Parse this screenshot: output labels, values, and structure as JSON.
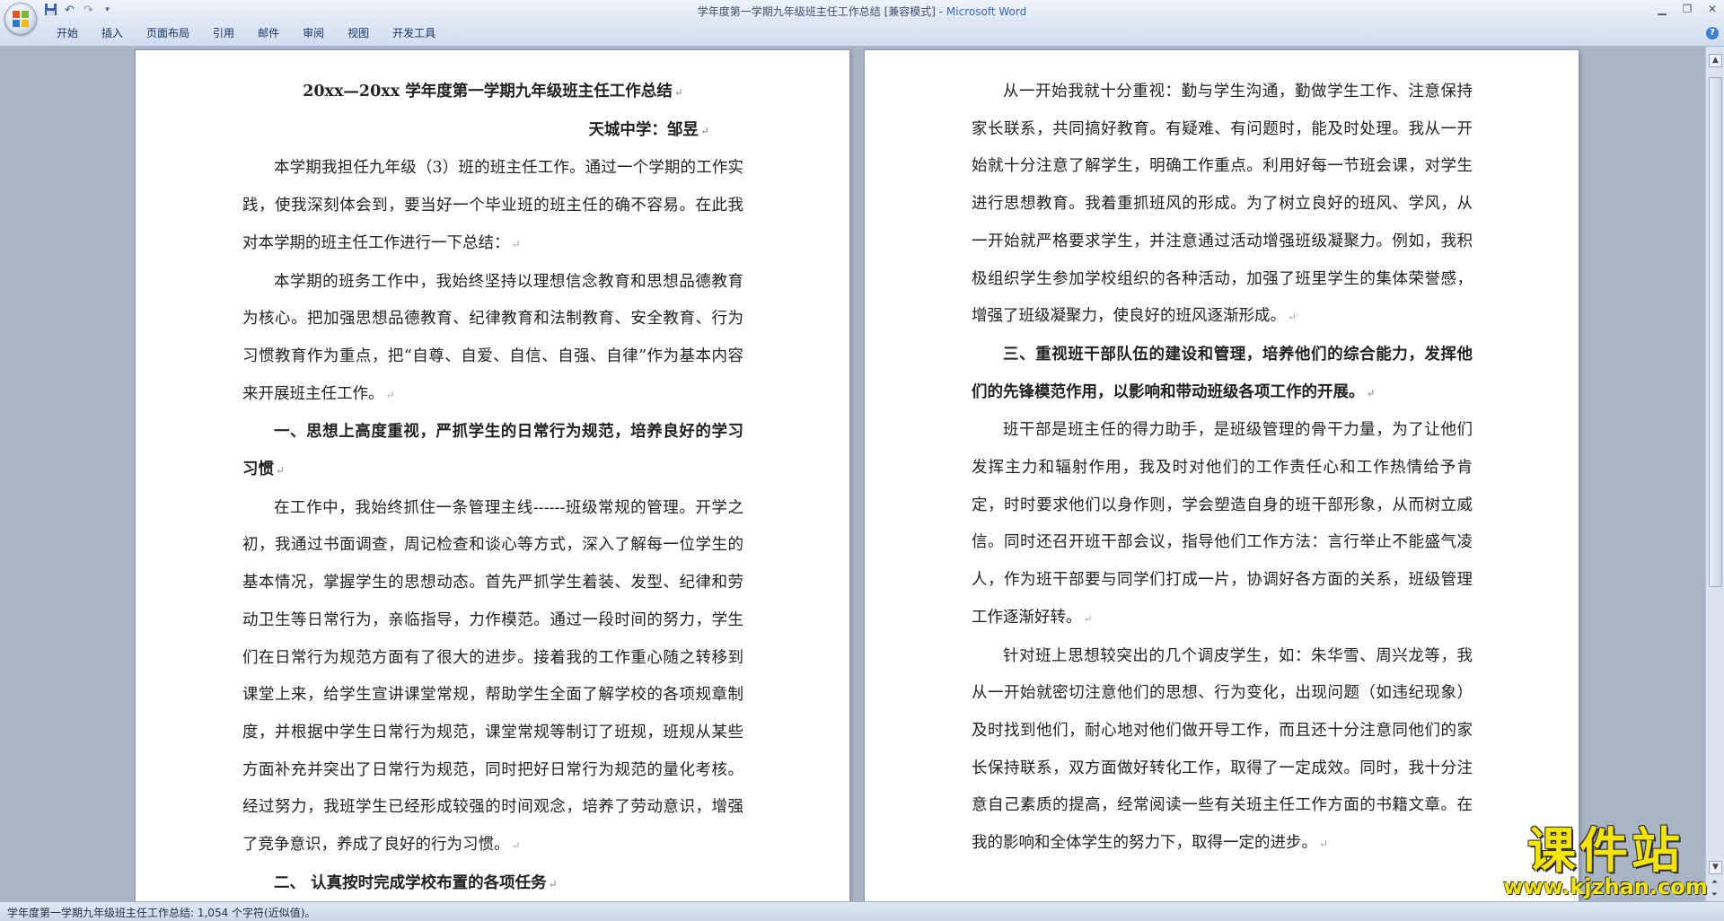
{
  "window": {
    "title": "学年度第一学期九年级班主任工作总结 [兼容模式] - ",
    "app_name": "Microsoft Word"
  },
  "quick_access": {
    "icons": [
      "save-icon",
      "undo-icon",
      "redo-icon",
      "customize-icon"
    ]
  },
  "ribbon": {
    "tabs": [
      "开始",
      "插入",
      "页面布局",
      "引用",
      "邮件",
      "审阅",
      "视图",
      "开发工具"
    ]
  },
  "document": {
    "left_page": {
      "title": "20xx—20xx 学年度第一学期九年级班主任工作总结",
      "author": "天城中学：邹昱",
      "para1": "本学期我担任九年级（3）班的班主任工作。通过一个学期的工作实践，使我深刻体会到，要当好一个毕业班的班主任的确不容易。在此我对本学期的班主任工作进行一下总结：",
      "para2": "本学期的班务工作中，我始终坚持以理想信念教育和思想品德教育为核心。把加强思想品德教育、纪律教育和法制教育、安全教育、行为习惯教育作为重点，把“自尊、自爱、自信、自强、自律”作为基本内容来开展班主任工作。",
      "heading1": "一、思想上高度重视，严抓学生的日常行为规范，培养良好的学习习惯",
      "para3": "在工作中，我始终抓住一条管理主线------班级常规的管理。开学之初，我通过书面调查，周记检查和谈心等方式，深入了解每一位学生的基本情况，掌握学生的思想动态。首先严抓学生着装、发型、纪律和劳动卫生等日常行为，亲临指导，力作模范。通过一段时间的努力，学生们在日常行为规范方面有了很大的进步。接着我的工作重心随之转移到课堂上来，给学生宣讲课堂常规，帮助学生全面了解学校的各项规章制度，并根据中学生日常行为规范，课堂常规等制订了班规，班规从某些方面补充并突出了日常行为规范，同时把好日常行为规范的量化考核。经过努力，我班学生已经形成较强的时间观念，培养了劳动意识，增强了竞争意识，养成了良好的行为习惯。",
      "heading2": "二、 认真按时完成学校布置的各项任务"
    },
    "right_page": {
      "para1": "从一开始我就十分重视：勤与学生沟通，勤做学生工作、注意保持家长联系，共同搞好教育。有疑难、有问题时，能及时处理。我从一开始就十分注意了解学生，明确工作重点。利用好每一节班会课，对学生进行思想教育。我着重抓班风的形成。为了树立良好的班风、学风，从一开始就严格要求学生，并注意通过活动增强班级凝聚力。例如，我积极组织学生参加学校组织的各种活动，加强了班里学生的集体荣誉感，增强了班级凝聚力，使良好的班风逐渐形成。",
      "heading3": "三、重视班干部队伍的建设和管理，培养他们的综合能力，发挥他们的先锋模范作用，以影响和带动班级各项工作的开展。",
      "para2": "班干部是班主任的得力助手，是班级管理的骨干力量，为了让他们发挥主力和辐射作用，我及时对他们的工作责任心和工作热情给予肯定，时时要求他们以身作则，学会塑造自身的班干部形象，从而树立威信。同时还召开班干部会议，指导他们工作方法：言行举止不能盛气凌人，作为班干部要与同学们打成一片，协调好各方面的关系，班级管理工作逐渐好转。",
      "para3": "针对班上思想较突出的几个调皮学生，如：朱华雪、周兴龙等，我从一开始就密切注意他们的思想、行为变化，出现问题（如违纪现象）及时找到他们，耐心地对他们做开导工作，而且还十分注意同他们的家长保持联系，双方面做好转化工作，取得了一定成效。同时，我十分注意自己素质的提高，经常阅读一些有关班主任工作方面的书籍文章。在我的影响和全体学生的努力下，取得一定的进步。"
    },
    "paragraph_mark": "↵"
  },
  "statusbar": {
    "text": "学年度第一学期九年级班主任工作总结: 1,054 个字符(近似值)。"
  },
  "watermark": {
    "title": "课件站",
    "url": "www.kjzhan.com"
  },
  "colors": {
    "workspace": "#a9b4c4",
    "watermark_yellow": "#f4e500"
  }
}
